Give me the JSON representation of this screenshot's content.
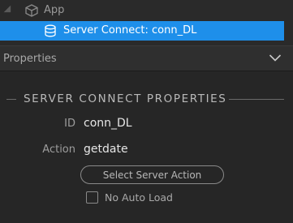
{
  "tree": {
    "app_label": "App",
    "selected_label": "Server Connect: conn_DL",
    "selected_bg": "#1e8fea",
    "app_icon": "cube-icon",
    "selected_icon": "database-icon"
  },
  "properties": {
    "header_title": "Properties",
    "header_icon": "chevron-down-icon",
    "section_title": "SERVER CONNECT PROPERTIES",
    "fields": {
      "id_label": "ID",
      "id_value": "conn_DL",
      "action_label": "Action",
      "action_value": "getdate"
    },
    "select_action_button": "Select Server Action",
    "no_auto_load_label": "No Auto Load",
    "no_auto_load_checked": false
  }
}
